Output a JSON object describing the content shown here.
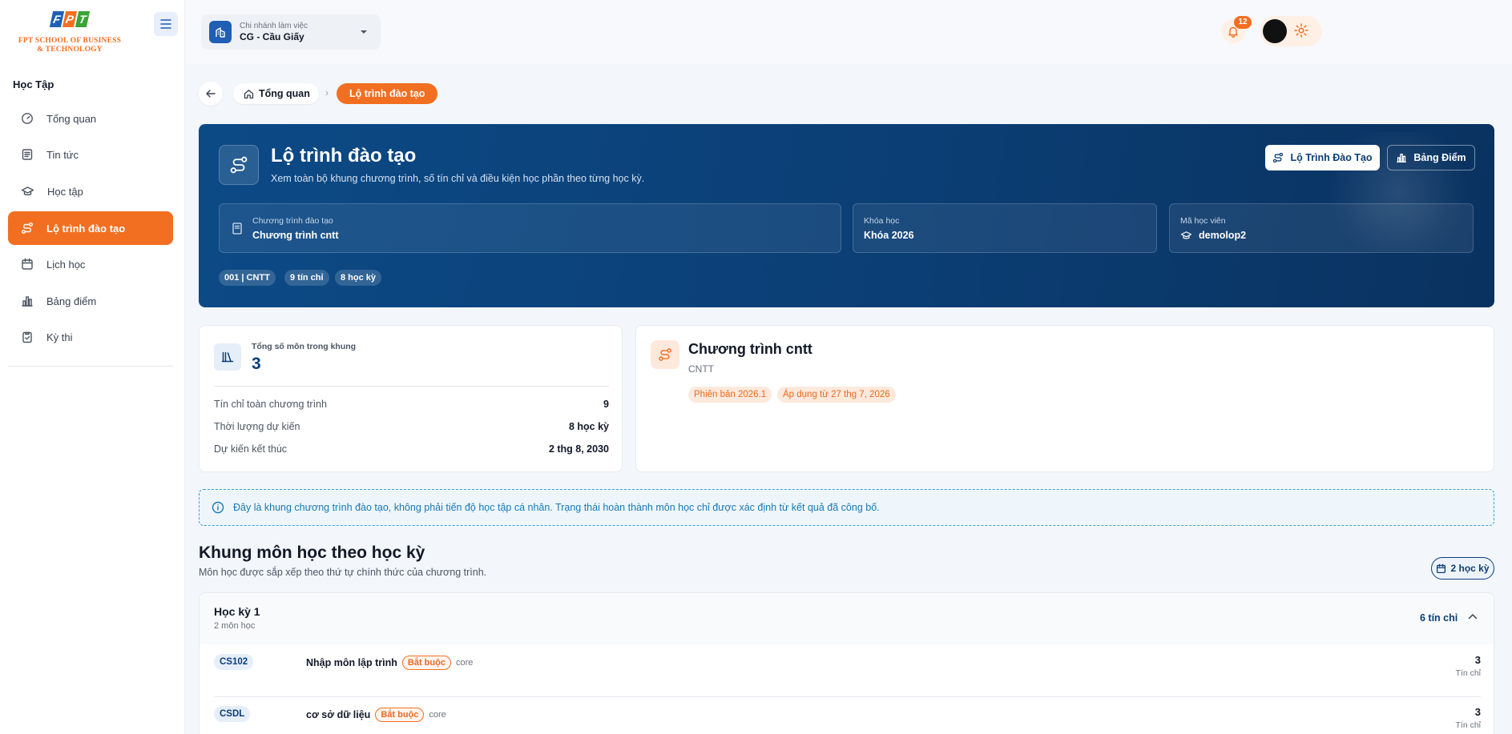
{
  "brand": {
    "letters": [
      "F",
      "P",
      "T"
    ],
    "letter_colors": [
      "#1f5fb4",
      "#f26f21",
      "#3aa535"
    ],
    "name_line1": "FPT SCHOOL OF BUSINESS",
    "name_line2": "& TECHNOLOGY",
    "accent": "#f26f21",
    "primary": "#0b3e74"
  },
  "sidebar": {
    "section": "Học Tập",
    "items": [
      {
        "label": "Tổng quan",
        "icon": "dashboard-icon",
        "active": false
      },
      {
        "label": "Tin tức",
        "icon": "news-icon",
        "active": false
      },
      {
        "label": "Học tập",
        "icon": "graduation-cap-icon",
        "active": false
      },
      {
        "label": "Lộ trình đào tạo",
        "icon": "route-icon",
        "active": true
      },
      {
        "label": "Lịch học",
        "icon": "calendar-icon",
        "active": false
      },
      {
        "label": "Bảng điểm",
        "icon": "bar-chart-icon",
        "active": false
      },
      {
        "label": "Kỳ thi",
        "icon": "clipboard-check-icon",
        "active": false
      }
    ]
  },
  "header": {
    "branch_label": "Chi nhánh làm việc",
    "branch_value": "CG - Cầu Giấy",
    "notification_count": "12"
  },
  "breadcrumb": {
    "home": "Tổng quan",
    "separator": "›",
    "current": "Lộ trình đào tạo"
  },
  "hero": {
    "title": "Lộ trình đào tạo",
    "subtitle": "Xem toàn bộ khung chương trình, số tín chỉ và điều kiện học phần theo từng học kỳ.",
    "btn_roadmap": "Lộ Trình Đào Tạo",
    "btn_grades": "Bảng Điểm",
    "cards": [
      {
        "label": "Chương trình đào tạo",
        "value": "Chương trình cntt"
      },
      {
        "label": "Khóa học",
        "value": "Khóa 2026"
      },
      {
        "label": "Mã học viên",
        "value": "demolop2"
      }
    ],
    "tags": [
      "001 | CNTT",
      "9 tín chỉ",
      "8 học kỳ"
    ]
  },
  "stats": {
    "label": "Tổng số môn trong khung",
    "value": "3",
    "rows": [
      {
        "label": "Tín chỉ toàn chương trình",
        "value": "9"
      },
      {
        "label": "Thời lượng dự kiến",
        "value": "8 học kỳ"
      },
      {
        "label": "Dự kiến kết thúc",
        "value": "2 thg 8, 2030"
      }
    ]
  },
  "program": {
    "title": "Chương trình cntt",
    "code": "CNTT",
    "version": "Phiên bản 2026.1",
    "applied": "Áp dụng từ 27 thg 7, 2026"
  },
  "info_notice": "Đây là khung chương trình đào tạo, không phải tiến độ học tập cá nhân. Trạng thái hoàn thành môn học chỉ được xác định từ kết quả đã công bố.",
  "curriculum": {
    "title": "Khung môn học theo học kỳ",
    "subtitle": "Môn học được sắp xếp theo thứ tự chính thức của chương trình.",
    "semester_count": "2 học kỳ",
    "terms": [
      {
        "title": "Học kỳ 1",
        "subtitle": "2 môn học",
        "credits": "6 tín chỉ",
        "courses": [
          {
            "code": "CS102",
            "name": "Nhập môn lập trình",
            "requirement": "Bắt buộc",
            "type": "core",
            "credits": "3",
            "credits_label": "Tín chỉ"
          },
          {
            "code": "CSDL",
            "name": "cơ sở dữ liệu",
            "requirement": "Bắt buộc",
            "type": "core",
            "credits": "3",
            "credits_label": "Tín chỉ"
          }
        ]
      }
    ]
  }
}
